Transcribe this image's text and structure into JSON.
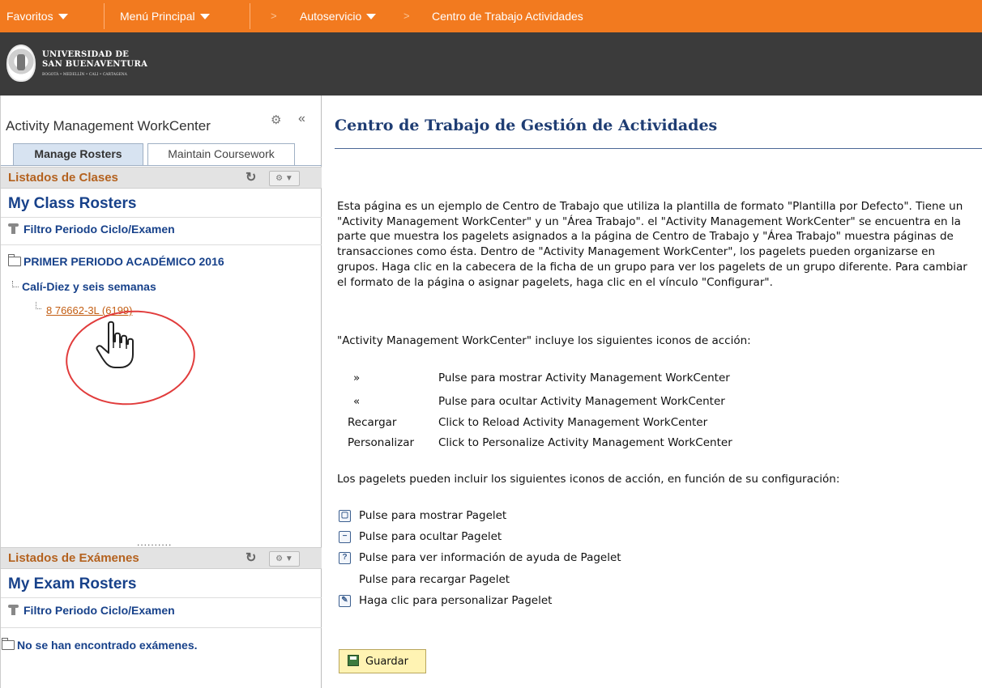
{
  "topnav": {
    "favoritos": "Favoritos",
    "menu_principal": "Menú Principal",
    "sep": ">",
    "autoservicio": "Autoservicio",
    "current_page": "Centro de Trabajo Actividades",
    "accent_color": "#f27a1f"
  },
  "logo": {
    "line1": "UNIVERSIDAD DE",
    "line2": "SAN BUENAVENTURA",
    "line3": "BOGOTÁ • MEDELLÍN • CALI • CARTAGENA"
  },
  "workcenter": {
    "title": "Activity Management WorkCenter",
    "collapse_glyph": "«",
    "tabs": [
      {
        "label": "Manage Rosters",
        "selected": true
      },
      {
        "label": "Maintain Coursework",
        "selected": false
      }
    ],
    "class_section": {
      "header": "Listados de Clases",
      "roster_title": "My Class Rosters",
      "filter_label": "Filtro Periodo Ciclo/Examen",
      "term": "PRIMER PERIODO ACADÉMICO 2016",
      "session": "Calí-Diez y seis semanas",
      "class_link": "8 76662-3L (6199)"
    },
    "splitter": "..........",
    "exam_section": {
      "header": "Listados de Exámenes",
      "roster_title": "My Exam Rosters",
      "filter_label": "Filtro Periodo Ciclo/Examen",
      "empty_message": "No se han encontrado exámenes."
    }
  },
  "main": {
    "title": "Centro de Trabajo de Gestión de Actividades",
    "intro": "Esta página es un ejemplo de Centro de Trabajo que utiliza la plantilla de formato \"Plantilla por Defecto\". Tiene un \"Activity Management WorkCenter\" y un \"Área Trabajo\". el \"Activity Management WorkCenter\" se encuentra en la parte que muestra los pagelets asignados a la página de Centro de Trabajo y \"Área Trabajo\" muestra páginas de transacciones como ésta. Dentro de \"Activity Management WorkCenter\", los pagelets pueden organizarse en grupos. Haga clic en la cabecera de la ficha de un grupo para ver los pagelets de un grupo diferente. Para cambiar el formato de la página o asignar pagelets, haga clic en el vínculo \"Configurar\".",
    "actions_heading": "\"Activity Management WorkCenter\" incluye los siguientes iconos de acción:",
    "actions": [
      {
        "key": "»",
        "desc": "Pulse para mostrar Activity Management WorkCenter"
      },
      {
        "key": "«",
        "desc": "Pulse para ocultar Activity Management WorkCenter"
      },
      {
        "key": "Recargar",
        "desc": "Click to Reload Activity Management WorkCenter"
      },
      {
        "key": "Personalizar",
        "desc": "Click to Personalize Activity Management WorkCenter"
      }
    ],
    "pagelets_heading": "Los pagelets pueden incluir los siguientes iconos de acción, en función de su configuración:",
    "pagelet_actions": [
      {
        "icon": "maximize-icon",
        "label": "Pulse para mostrar Pagelet"
      },
      {
        "icon": "minimize-icon",
        "label": "Pulse para ocultar Pagelet"
      },
      {
        "icon": "help-icon",
        "label": "Pulse para ver información de ayuda de Pagelet"
      },
      {
        "icon": "",
        "label": "Pulse para recargar Pagelet"
      },
      {
        "icon": "edit-icon",
        "label": "Haga clic para personalizar Pagelet"
      }
    ],
    "save_label": "Guardar"
  }
}
